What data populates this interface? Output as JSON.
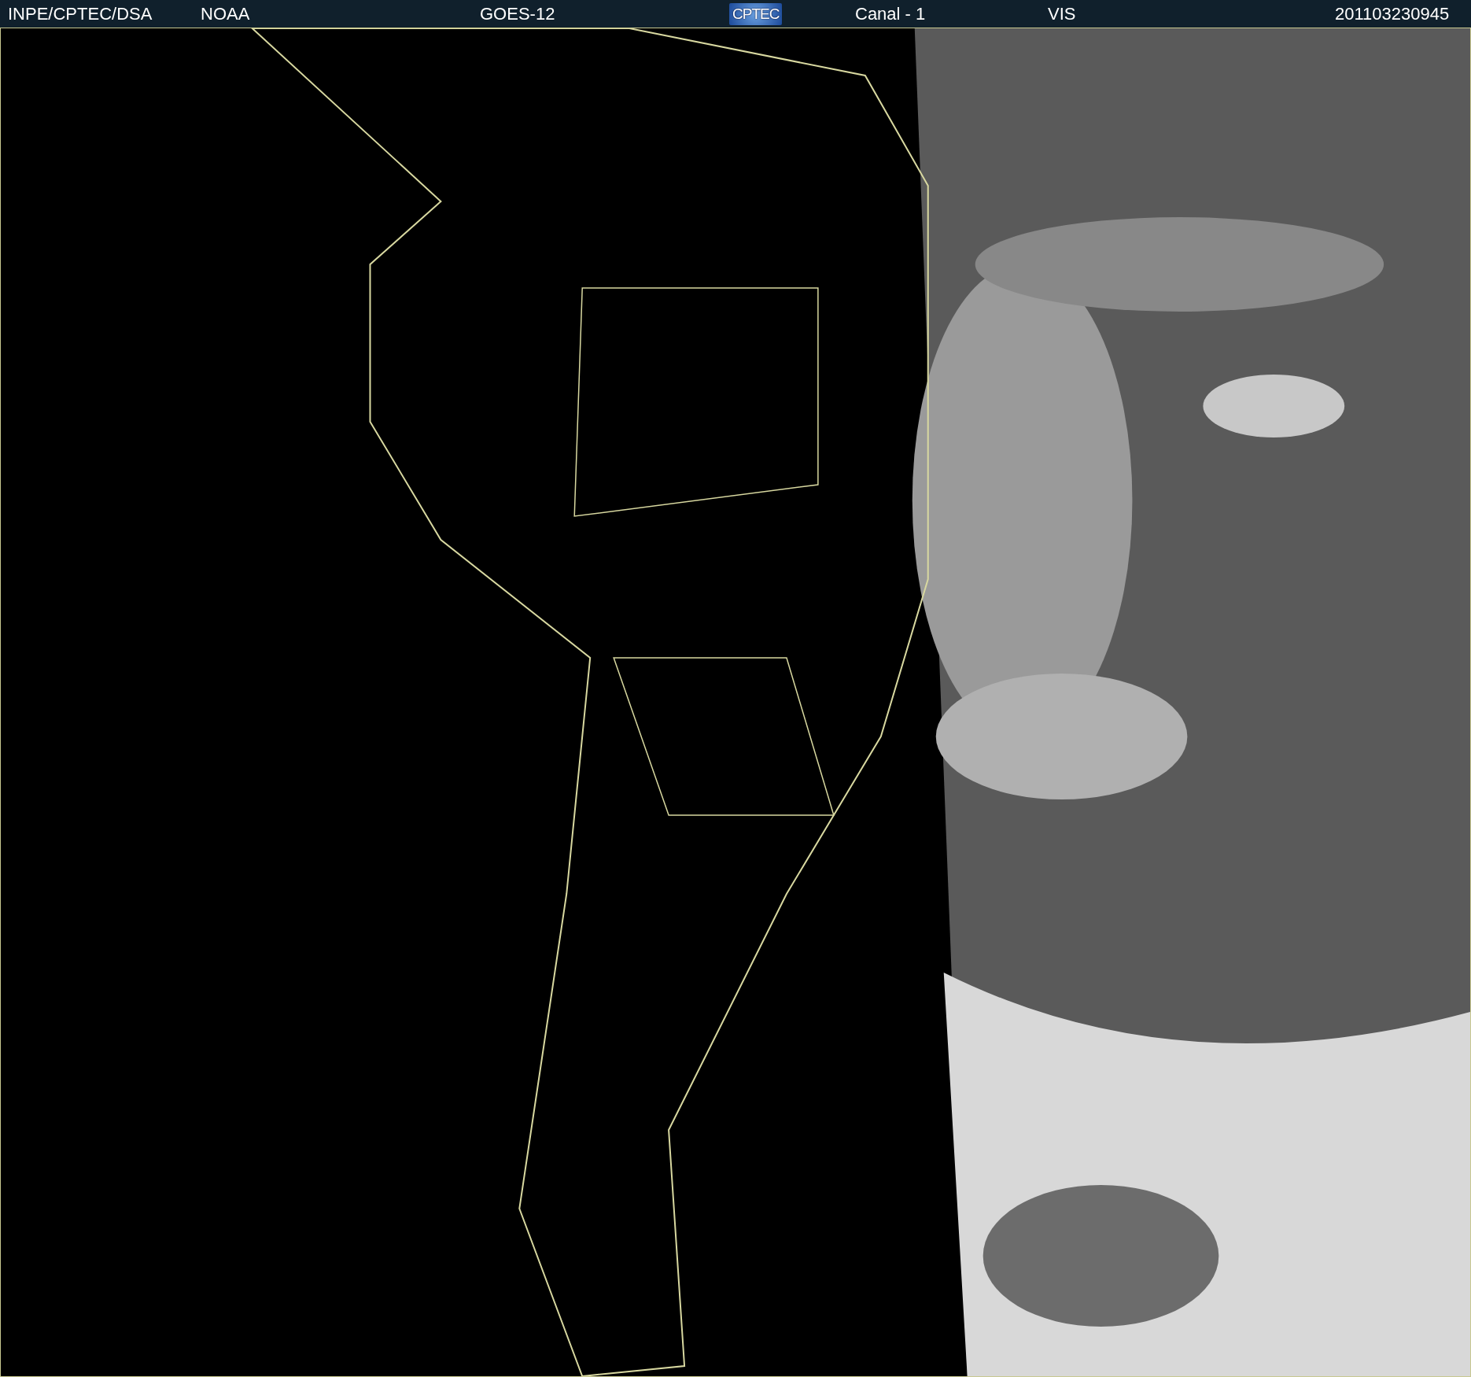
{
  "header": {
    "items": [
      {
        "kind": "text",
        "text": "INPE/CPTEC/DSA"
      },
      {
        "kind": "text",
        "text": "NOAA"
      },
      {
        "kind": "text",
        "text": "GOES-12"
      },
      {
        "kind": "logo",
        "text": "CPTEC"
      },
      {
        "kind": "text",
        "text": "Canal - 1"
      },
      {
        "kind": "text",
        "text": "VIS"
      },
      {
        "kind": "text",
        "text": "201103230945"
      }
    ]
  }
}
